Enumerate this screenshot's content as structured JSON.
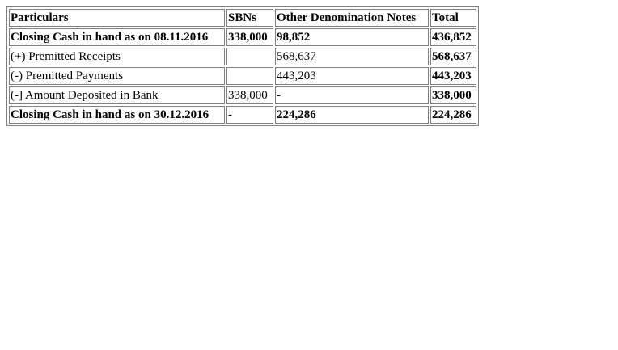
{
  "table": {
    "headers": [
      "Particulars",
      "SBNs",
      "Other Denomination Notes",
      "Total"
    ],
    "rows": [
      {
        "particulars": "Closing Cash in hand as on 08.11.2016",
        "sbns": "338,000",
        "other": "98,852",
        "total": "436,852"
      },
      {
        "particulars": "(+) Premitted Receipts",
        "sbns": "",
        "other": "568,637",
        "total": "568,637"
      },
      {
        "particulars": "(-) Premitted Payments",
        "sbns": "",
        "other": "443,203",
        "total": "443,203"
      },
      {
        "particulars": "(-] Amount Deposited in Bank",
        "sbns": "338,000",
        "other": "-",
        "total": "338,000"
      },
      {
        "particulars": "Closing Cash in hand as on 30.12.2016",
        "sbns": "-",
        "other": "224,286",
        "total": "224,286"
      }
    ]
  }
}
